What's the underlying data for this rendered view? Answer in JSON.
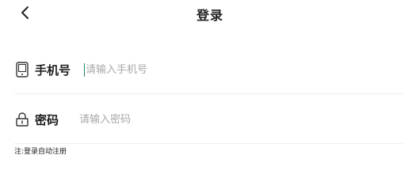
{
  "header": {
    "back_icon": "chevron-left-icon",
    "title": "登录"
  },
  "form": {
    "phone": {
      "icon": "mobile-phone-icon",
      "label": "手机号",
      "placeholder": "请输入手机号",
      "value": ""
    },
    "password": {
      "icon": "lock-icon",
      "label": "密码",
      "placeholder": "请输入密码",
      "value": ""
    }
  },
  "note": "注:登录自动注册",
  "colors": {
    "caret": "#1f8a5a",
    "placeholder": "#a8a8a8",
    "divider": "#efefef"
  }
}
